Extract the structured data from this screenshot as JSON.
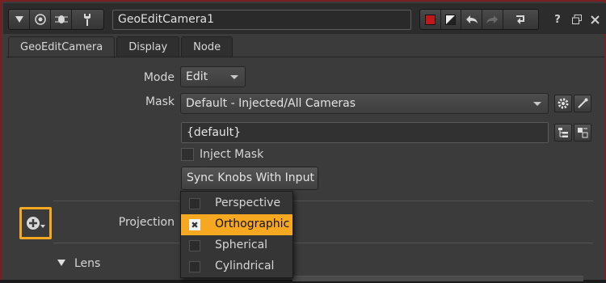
{
  "titlebar": {
    "node_name": "GeoEditCamera1",
    "left_icons": [
      "collapse-triangle-icon",
      "target-icon",
      "bug-icon",
      "wrench-icon"
    ],
    "right_icons": [
      "node-color-icon",
      "contrast-icon",
      "undo-icon",
      "redo-icon",
      "revert-icon"
    ],
    "help": "?",
    "float_icon": "float-window-icon",
    "close_icon": "close-icon",
    "accent_color": "#cc2222"
  },
  "tabs": [
    {
      "label": "GeoEditCamera",
      "active": true
    },
    {
      "label": "Display",
      "active": false
    },
    {
      "label": "Node",
      "active": false
    }
  ],
  "mode": {
    "label": "Mode",
    "value": "Edit"
  },
  "mask": {
    "label": "Mask",
    "value": "Default - Injected/All Cameras"
  },
  "mask_field": {
    "value": "{default}"
  },
  "inject_mask": {
    "label": "Inject Mask",
    "checked": false
  },
  "sync_button": {
    "label": "Sync Knobs With Input"
  },
  "projection": {
    "label": "Projection"
  },
  "projection_menu": {
    "items": [
      {
        "label": "Perspective",
        "checked": false
      },
      {
        "label": "Orthographic",
        "checked": true
      },
      {
        "label": "Spherical",
        "checked": false
      },
      {
        "label": "Cylindrical",
        "checked": false
      }
    ],
    "highlight_color": "#f6a821"
  },
  "lens": {
    "label": "Lens"
  },
  "colors": {
    "highlight": "#f6a821",
    "panel_bg": "#3b3b3b",
    "border_red": "#7a1f1f"
  }
}
